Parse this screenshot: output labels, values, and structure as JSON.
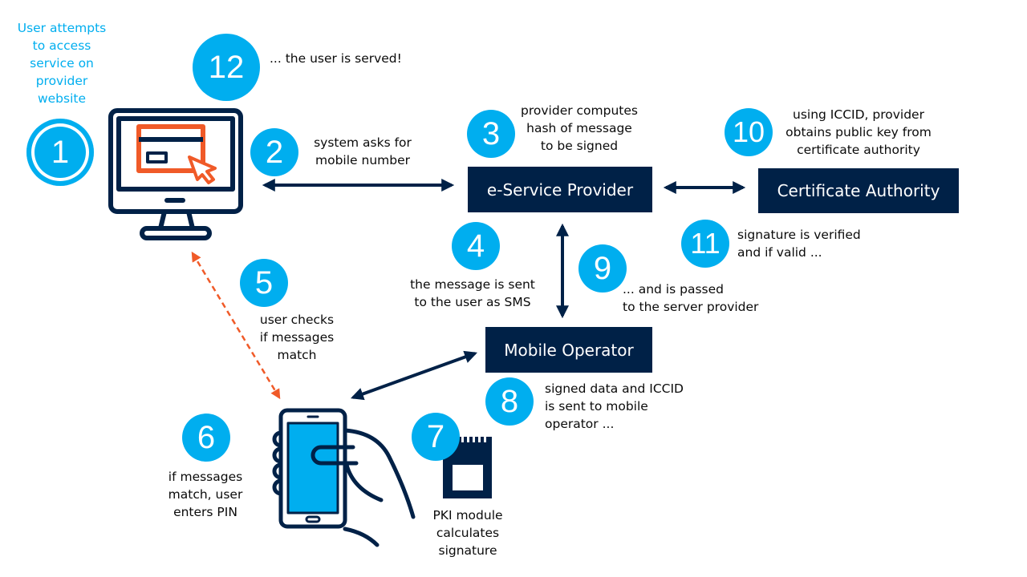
{
  "colors": {
    "navy": "#002147",
    "cyan": "#00aeef",
    "orange": "#f05a28"
  },
  "icons": [
    "monitor-icon",
    "phone-in-hand-icon",
    "sim-card-icon"
  ],
  "entities": {
    "provider": "e-Service Provider",
    "ca": "Certificate Authority",
    "operator": "Mobile Operator"
  },
  "steps": [
    {
      "n": "1",
      "text": [
        "User attempts",
        "to access",
        "service on",
        "provider",
        "website"
      ]
    },
    {
      "n": "2",
      "text": [
        "system asks for",
        "mobile number"
      ]
    },
    {
      "n": "3",
      "text": [
        "provider computes",
        "hash of message",
        "to be signed"
      ]
    },
    {
      "n": "4",
      "text": [
        "the message is sent",
        "to the user as SMS"
      ]
    },
    {
      "n": "5",
      "text": [
        "user checks",
        "if messages",
        "match"
      ]
    },
    {
      "n": "6",
      "text": [
        "if messages",
        "match, user",
        "enters PIN"
      ]
    },
    {
      "n": "7",
      "text": [
        "PKI module",
        "calculates",
        "signature"
      ]
    },
    {
      "n": "8",
      "text": [
        "signed data and ICCID",
        "is sent to mobile",
        "operator ..."
      ]
    },
    {
      "n": "9",
      "text": [
        "... and is passed",
        "to the server provider"
      ]
    },
    {
      "n": "10",
      "text": [
        "using ICCID, provider",
        "obtains public key from",
        "certificate authority"
      ]
    },
    {
      "n": "11",
      "text": [
        "signature is verified",
        "and if valid ..."
      ]
    },
    {
      "n": "12",
      "text": [
        "... the user is served!"
      ]
    }
  ]
}
